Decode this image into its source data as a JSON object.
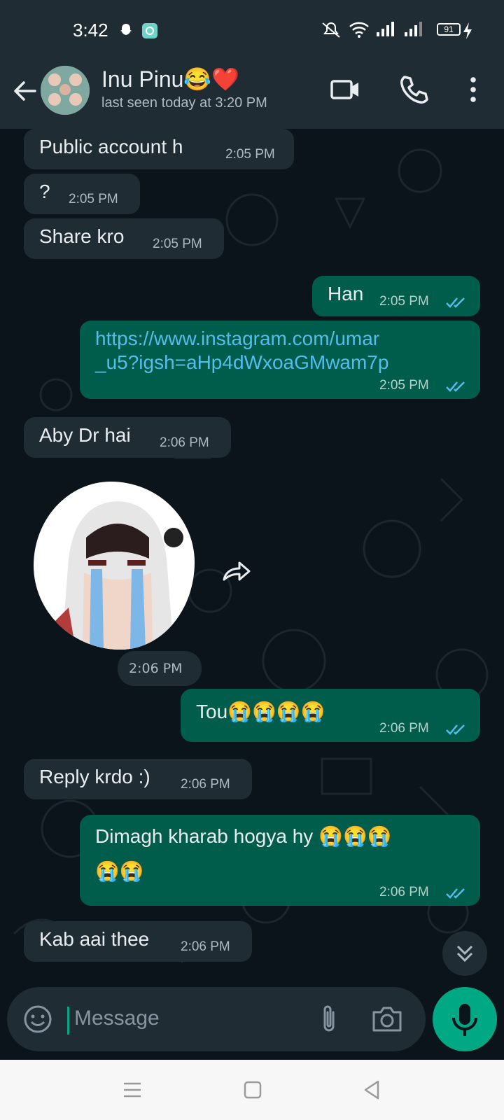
{
  "status_bar": {
    "time": "3:42",
    "battery": "91",
    "icons": [
      "snapchat-icon",
      "app-notification-icon",
      "mute-icon",
      "wifi-icon",
      "signal-icon",
      "signal-icon",
      "battery-icon",
      "charging-icon"
    ]
  },
  "header": {
    "contact_name": "Inu Pinu😂❤️",
    "last_seen": "last seen today at 3:20 PM",
    "icons": [
      "back-arrow-icon",
      "video-call-icon",
      "voice-call-icon",
      "more-options-icon"
    ]
  },
  "messages": [
    {
      "direction": "incoming",
      "text": "Public account h",
      "time": "2:05 PM"
    },
    {
      "direction": "incoming",
      "text": "?",
      "time": "2:05 PM"
    },
    {
      "direction": "incoming",
      "text": "Share kro",
      "time": "2:05 PM"
    },
    {
      "direction": "outgoing",
      "text": "Han",
      "time": "2:05 PM",
      "status": "read"
    },
    {
      "direction": "outgoing",
      "text_line1": "https://www.instagram.com/umar",
      "text_line2": "_u5?igsh=aHp4dWxoaGMwam7p",
      "time": "2:05 PM",
      "status": "read"
    },
    {
      "direction": "incoming",
      "text": "Aby Dr hai",
      "time": "2:06 PM"
    },
    {
      "direction": "incoming",
      "type": "sticker",
      "time": "2:06 PM"
    },
    {
      "direction": "outgoing",
      "text": "Tou😭😭😭😭",
      "time": "2:06 PM",
      "status": "read"
    },
    {
      "direction": "incoming",
      "text": "Reply krdo :)",
      "time": "2:06 PM"
    },
    {
      "direction": "outgoing",
      "text_line1": "Dimagh kharab hogya hy 😭😭😭",
      "text_line2": "😭😭",
      "time": "2:06 PM",
      "status": "read"
    },
    {
      "direction": "incoming",
      "text": "Kab aai thee",
      "time": "2:06 PM"
    }
  ],
  "composer": {
    "placeholder": "Message",
    "icons": [
      "emoji-icon",
      "attach-icon",
      "camera-icon",
      "mic-icon"
    ]
  },
  "colors": {
    "background": "#0b141a",
    "header": "#1f2c34",
    "incoming_bubble": "#1f2c34",
    "outgoing_bubble": "#005c4b",
    "accent": "#00a884",
    "read_ticks": "#53bdeb",
    "link": "#53bdeb"
  }
}
